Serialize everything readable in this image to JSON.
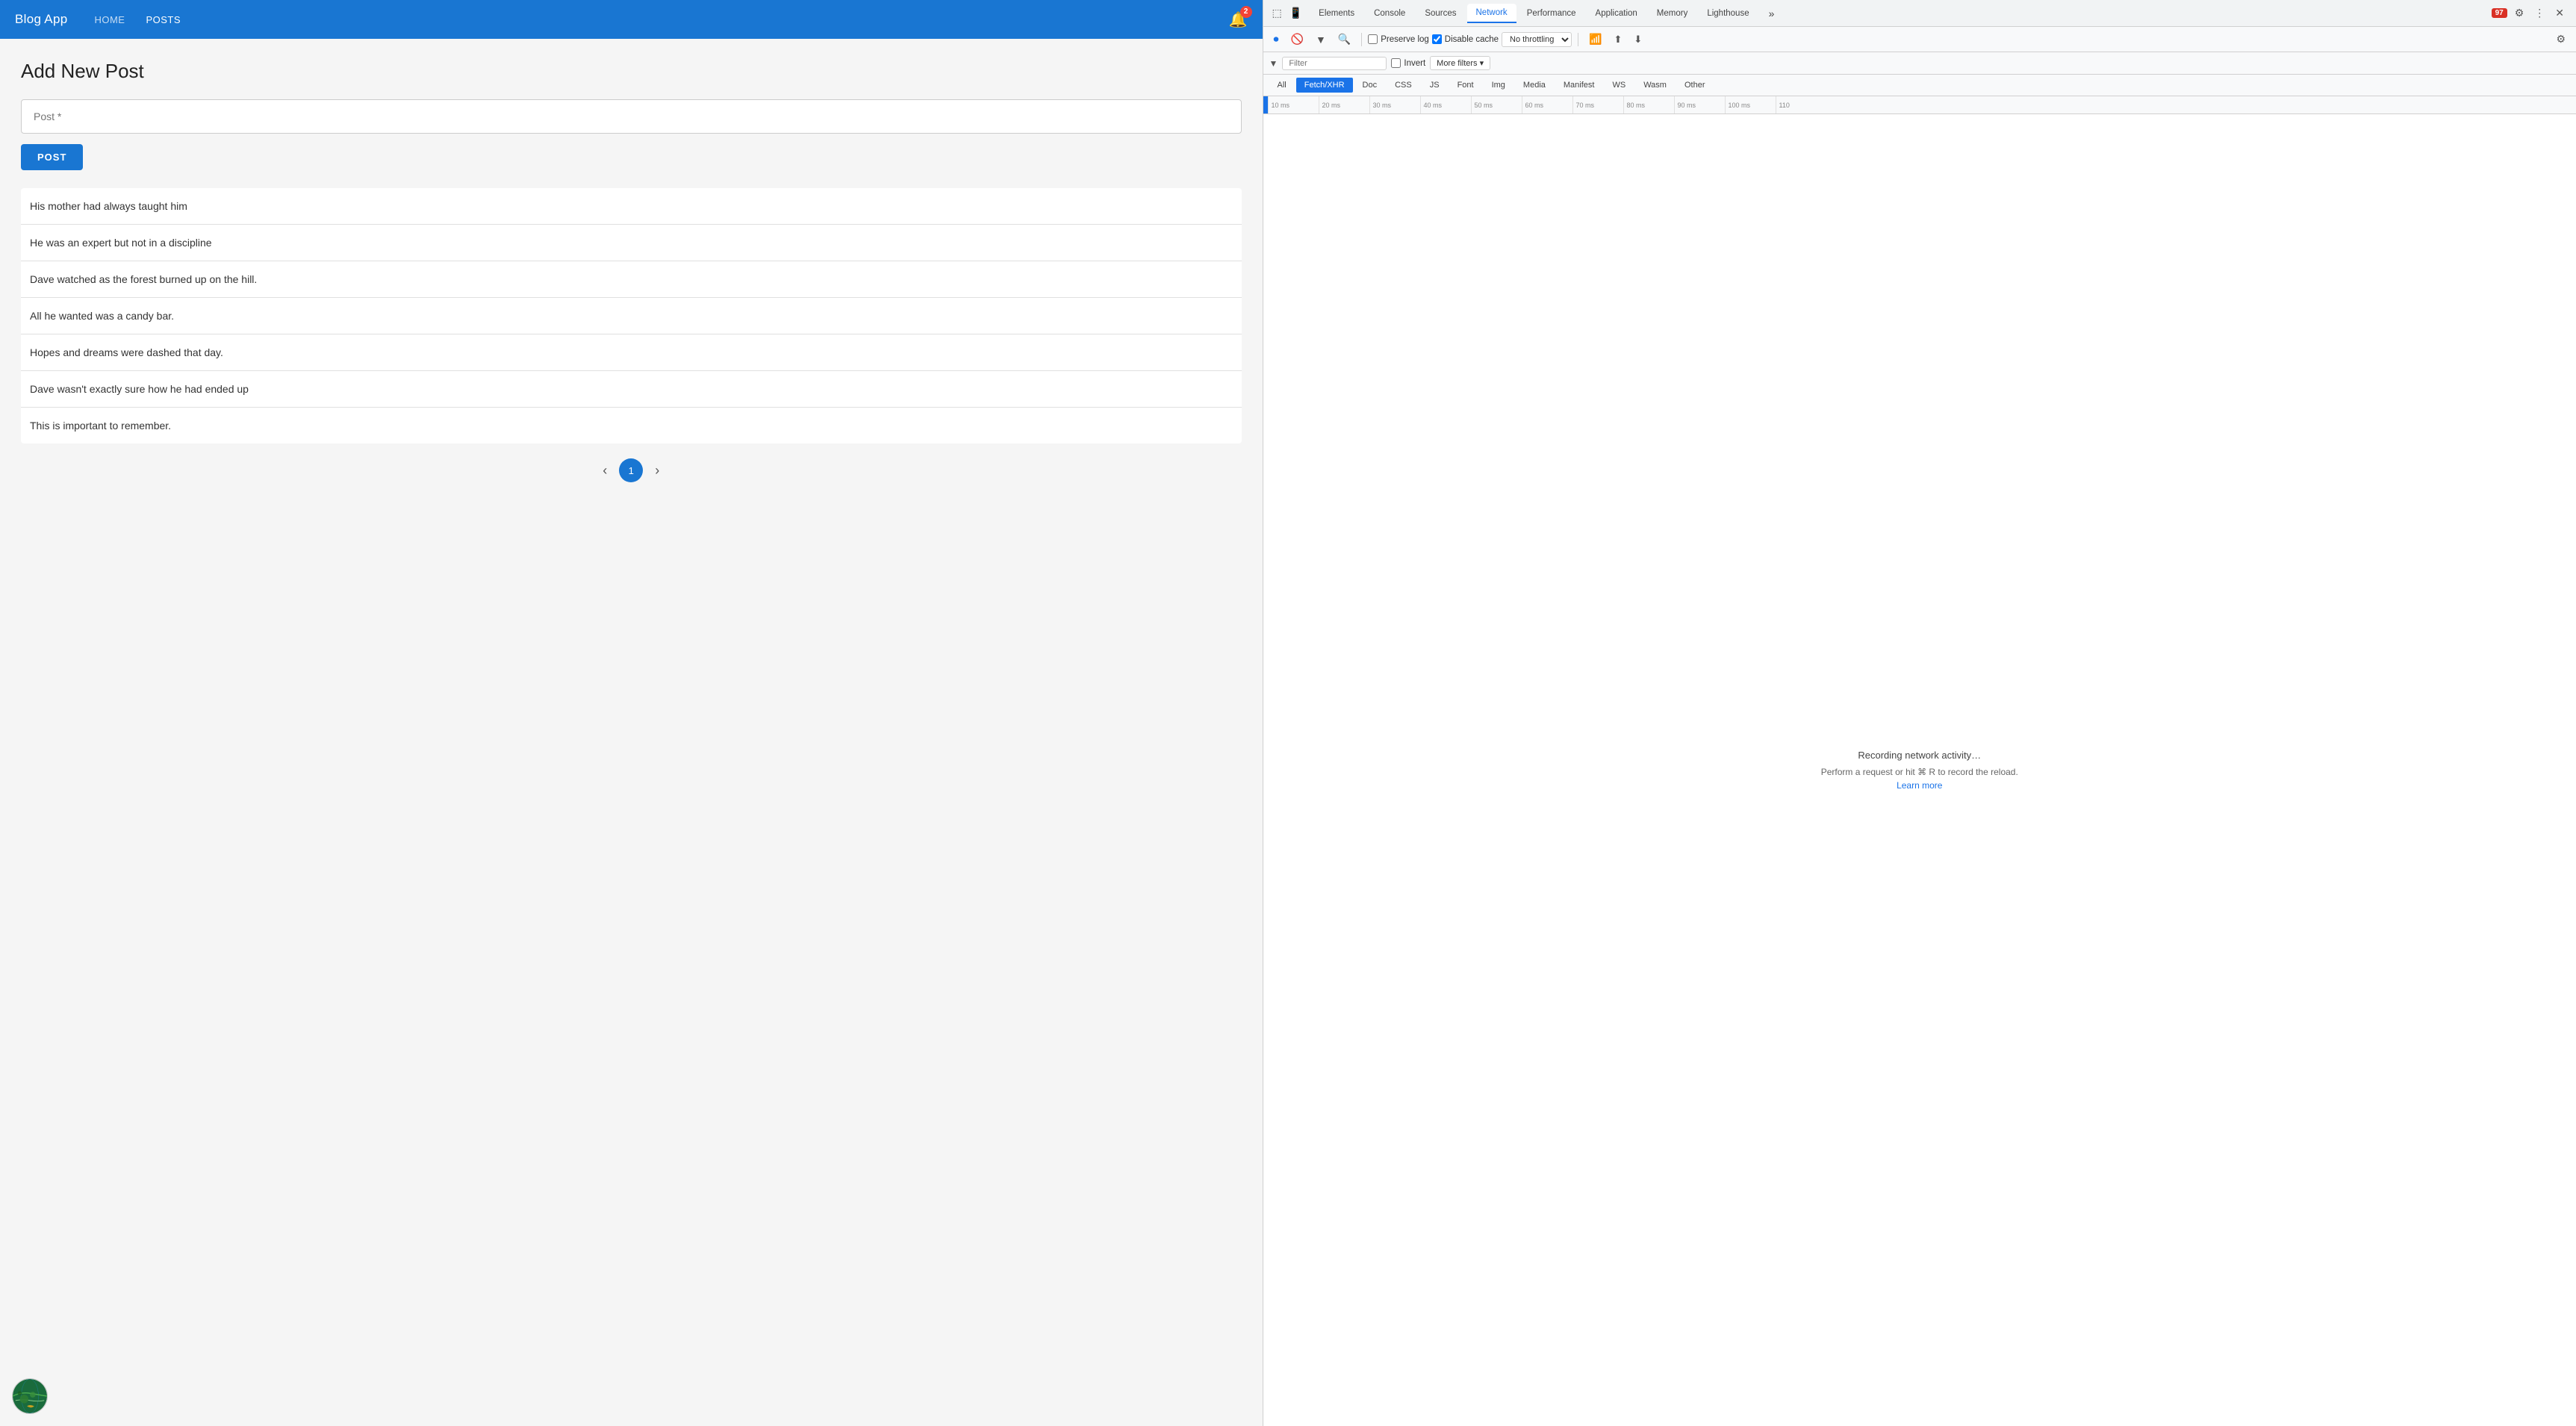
{
  "app": {
    "title": "Blog App",
    "nav": {
      "home_label": "HOME",
      "posts_label": "POSTS",
      "bell_count": "2"
    },
    "page_title": "Add New Post",
    "form": {
      "input_placeholder": "Post *",
      "submit_label": "POST"
    },
    "posts": [
      "His mother had always taught him",
      "He was an expert but not in a discipline",
      "Dave watched as the forest burned up on the hill.",
      "All he wanted was a candy bar.",
      "Hopes and dreams were dashed that day.",
      "Dave wasn't exactly sure how he had ended up",
      "This is important to remember."
    ],
    "pagination": {
      "prev": "‹",
      "current": "1",
      "next": "›"
    }
  },
  "devtools": {
    "tabs": [
      {
        "label": "Elements",
        "active": false
      },
      {
        "label": "Console",
        "active": false
      },
      {
        "label": "Sources",
        "active": false
      },
      {
        "label": "Network",
        "active": true
      },
      {
        "label": "Performance",
        "active": false
      },
      {
        "label": "Application",
        "active": false
      },
      {
        "label": "Memory",
        "active": false
      },
      {
        "label": "Lighthouse",
        "active": false
      }
    ],
    "error_count": "97",
    "toolbar": {
      "record_title": "Record network log",
      "clear_title": "Clear",
      "filter_title": "Filter",
      "search_title": "Search",
      "preserve_log_label": "Preserve log",
      "disable_cache_label": "Disable cache",
      "throttling_value": "No throttling",
      "wifi_icon": "wifi",
      "upload_icon": "upload",
      "download_icon": "download",
      "settings_icon": "settings"
    },
    "filter_bar": {
      "filter_label": "Filter",
      "filter_placeholder": "Filter",
      "invert_label": "Invert",
      "more_filters_label": "More filters ▾"
    },
    "type_tabs": [
      {
        "label": "All",
        "active": false
      },
      {
        "label": "Fetch/XHR",
        "active": true
      },
      {
        "label": "Doc",
        "active": false
      },
      {
        "label": "CSS",
        "active": false
      },
      {
        "label": "JS",
        "active": false
      },
      {
        "label": "Font",
        "active": false
      },
      {
        "label": "Img",
        "active": false
      },
      {
        "label": "Media",
        "active": false
      },
      {
        "label": "Manifest",
        "active": false
      },
      {
        "label": "WS",
        "active": false
      },
      {
        "label": "Wasm",
        "active": false
      },
      {
        "label": "Other",
        "active": false
      }
    ],
    "timeline": {
      "ticks": [
        "10 ms",
        "20 ms",
        "30 ms",
        "40 ms",
        "50 ms",
        "60 ms",
        "70 ms",
        "80 ms",
        "90 ms",
        "100 ms",
        "110"
      ]
    },
    "recording": {
      "line1": "Recording network activity…",
      "line2": "Perform a request or hit ⌘ R to record the reload.",
      "learn_more": "Learn more"
    }
  }
}
